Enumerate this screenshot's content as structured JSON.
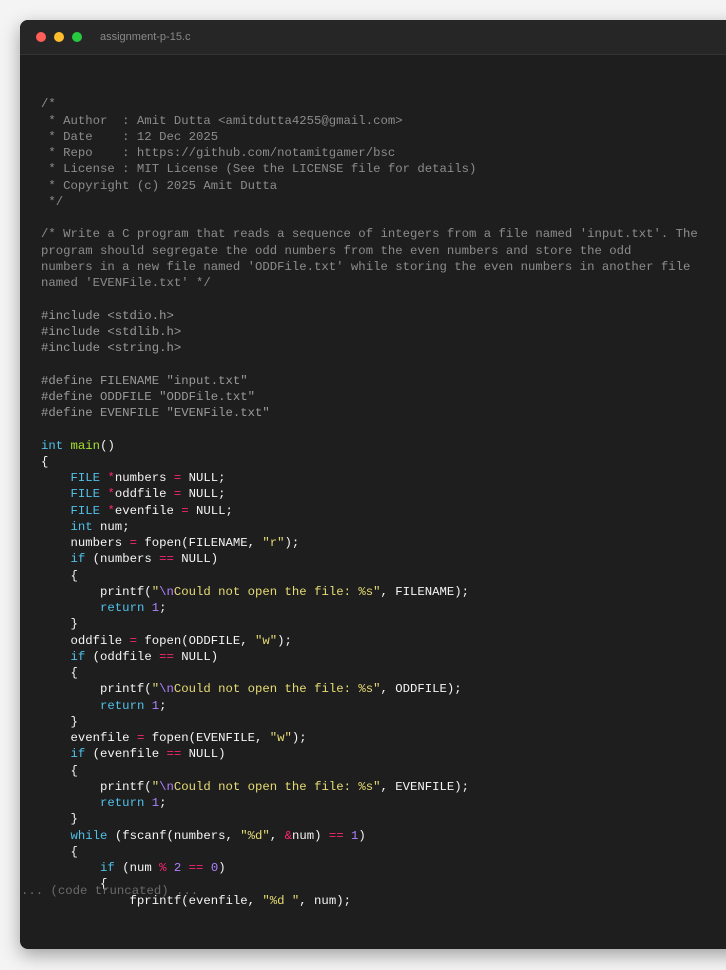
{
  "window": {
    "title": "assignment-p-15.c",
    "controls": {
      "close": "close-icon",
      "minimize": "minimize-icon",
      "maximize": "maximize-icon"
    }
  },
  "colors": {
    "background": "#1e1e1e",
    "titlebar": "#262626",
    "comment": "#8c8c8c",
    "keyword": "#4fc1e9",
    "function": "#a6e22e",
    "string": "#e6db74",
    "number": "#ae81ff",
    "operator": "#f92672"
  },
  "code": {
    "lines": [
      [],
      [
        {
          "t": "c",
          "v": "/*"
        }
      ],
      [
        {
          "t": "c",
          "v": " * Author  : Amit Dutta <amitdutta4255@gmail.com>"
        }
      ],
      [
        {
          "t": "c",
          "v": " * Date    : 12 Dec 2025"
        }
      ],
      [
        {
          "t": "c",
          "v": " * Repo    : https://github.com/notamitgamer/bsc"
        }
      ],
      [
        {
          "t": "c",
          "v": " * License : MIT License (See the LICENSE file for details)"
        }
      ],
      [
        {
          "t": "c",
          "v": " * Copyright (c) 2025 Amit Dutta"
        }
      ],
      [
        {
          "t": "c",
          "v": " */"
        }
      ],
      [],
      [
        {
          "t": "c",
          "v": "/* Write a C program that reads a sequence of integers from a file named 'input.txt'. The"
        }
      ],
      [
        {
          "t": "c",
          "v": "program should segregate the odd numbers from the even numbers and store the odd"
        }
      ],
      [
        {
          "t": "c",
          "v": "numbers in a new file named 'ODDFile.txt' while storing the even numbers in another file"
        }
      ],
      [
        {
          "t": "c",
          "v": "named 'EVENFile.txt' */"
        }
      ],
      [],
      [
        {
          "t": "p",
          "v": "#include <stdio.h>"
        }
      ],
      [
        {
          "t": "p",
          "v": "#include <stdlib.h>"
        }
      ],
      [
        {
          "t": "p",
          "v": "#include <string.h>"
        }
      ],
      [],
      [
        {
          "t": "p",
          "v": "#define FILENAME \"input.txt\""
        }
      ],
      [
        {
          "t": "p",
          "v": "#define ODDFILE \"ODDFile.txt\""
        }
      ],
      [
        {
          "t": "p",
          "v": "#define EVENFILE \"EVENFile.txt\""
        }
      ],
      [],
      [
        {
          "t": "k",
          "v": "int"
        },
        {
          "t": "x",
          "v": " "
        },
        {
          "t": "f",
          "v": "main"
        },
        {
          "t": "x",
          "v": "()"
        }
      ],
      [
        {
          "t": "x",
          "v": "{"
        }
      ],
      [
        {
          "t": "x",
          "v": "    "
        },
        {
          "t": "k",
          "v": "FILE"
        },
        {
          "t": "x",
          "v": " "
        },
        {
          "t": "o",
          "v": "*"
        },
        {
          "t": "x",
          "v": "numbers "
        },
        {
          "t": "o",
          "v": "="
        },
        {
          "t": "x",
          "v": " NULL;"
        }
      ],
      [
        {
          "t": "x",
          "v": "    "
        },
        {
          "t": "k",
          "v": "FILE"
        },
        {
          "t": "x",
          "v": " "
        },
        {
          "t": "o",
          "v": "*"
        },
        {
          "t": "x",
          "v": "oddfile "
        },
        {
          "t": "o",
          "v": "="
        },
        {
          "t": "x",
          "v": " NULL;"
        }
      ],
      [
        {
          "t": "x",
          "v": "    "
        },
        {
          "t": "k",
          "v": "FILE"
        },
        {
          "t": "x",
          "v": " "
        },
        {
          "t": "o",
          "v": "*"
        },
        {
          "t": "x",
          "v": "evenfile "
        },
        {
          "t": "o",
          "v": "="
        },
        {
          "t": "x",
          "v": " NULL;"
        }
      ],
      [
        {
          "t": "x",
          "v": "    "
        },
        {
          "t": "k",
          "v": "int"
        },
        {
          "t": "x",
          "v": " num;"
        }
      ],
      [
        {
          "t": "x",
          "v": "    numbers "
        },
        {
          "t": "o",
          "v": "="
        },
        {
          "t": "x",
          "v": " fopen(FILENAME, "
        },
        {
          "t": "s",
          "v": "\"r\""
        },
        {
          "t": "x",
          "v": ");"
        }
      ],
      [
        {
          "t": "x",
          "v": "    "
        },
        {
          "t": "k",
          "v": "if"
        },
        {
          "t": "x",
          "v": " (numbers "
        },
        {
          "t": "o",
          "v": "=="
        },
        {
          "t": "x",
          "v": " NULL)"
        }
      ],
      [
        {
          "t": "x",
          "v": "    {"
        }
      ],
      [
        {
          "t": "x",
          "v": "        printf("
        },
        {
          "t": "s",
          "v": "\""
        },
        {
          "t": "e",
          "v": "\\n"
        },
        {
          "t": "s",
          "v": "Could not open the file: %s\""
        },
        {
          "t": "x",
          "v": ", FILENAME);"
        }
      ],
      [
        {
          "t": "x",
          "v": "        "
        },
        {
          "t": "k",
          "v": "return"
        },
        {
          "t": "x",
          "v": " "
        },
        {
          "t": "n",
          "v": "1"
        },
        {
          "t": "x",
          "v": ";"
        }
      ],
      [
        {
          "t": "x",
          "v": "    }"
        }
      ],
      [
        {
          "t": "x",
          "v": "    oddfile "
        },
        {
          "t": "o",
          "v": "="
        },
        {
          "t": "x",
          "v": " fopen(ODDFILE, "
        },
        {
          "t": "s",
          "v": "\"w\""
        },
        {
          "t": "x",
          "v": ");"
        }
      ],
      [
        {
          "t": "x",
          "v": "    "
        },
        {
          "t": "k",
          "v": "if"
        },
        {
          "t": "x",
          "v": " (oddfile "
        },
        {
          "t": "o",
          "v": "=="
        },
        {
          "t": "x",
          "v": " NULL)"
        }
      ],
      [
        {
          "t": "x",
          "v": "    {"
        }
      ],
      [
        {
          "t": "x",
          "v": "        printf("
        },
        {
          "t": "s",
          "v": "\""
        },
        {
          "t": "e",
          "v": "\\n"
        },
        {
          "t": "s",
          "v": "Could not open the file: %s\""
        },
        {
          "t": "x",
          "v": ", ODDFILE);"
        }
      ],
      [
        {
          "t": "x",
          "v": "        "
        },
        {
          "t": "k",
          "v": "return"
        },
        {
          "t": "x",
          "v": " "
        },
        {
          "t": "n",
          "v": "1"
        },
        {
          "t": "x",
          "v": ";"
        }
      ],
      [
        {
          "t": "x",
          "v": "    }"
        }
      ],
      [
        {
          "t": "x",
          "v": "    evenfile "
        },
        {
          "t": "o",
          "v": "="
        },
        {
          "t": "x",
          "v": " fopen(EVENFILE, "
        },
        {
          "t": "s",
          "v": "\"w\""
        },
        {
          "t": "x",
          "v": ");"
        }
      ],
      [
        {
          "t": "x",
          "v": "    "
        },
        {
          "t": "k",
          "v": "if"
        },
        {
          "t": "x",
          "v": " (evenfile "
        },
        {
          "t": "o",
          "v": "=="
        },
        {
          "t": "x",
          "v": " NULL)"
        }
      ],
      [
        {
          "t": "x",
          "v": "    {"
        }
      ],
      [
        {
          "t": "x",
          "v": "        printf("
        },
        {
          "t": "s",
          "v": "\""
        },
        {
          "t": "e",
          "v": "\\n"
        },
        {
          "t": "s",
          "v": "Could not open the file: %s\""
        },
        {
          "t": "x",
          "v": ", EVENFILE);"
        }
      ],
      [
        {
          "t": "x",
          "v": "        "
        },
        {
          "t": "k",
          "v": "return"
        },
        {
          "t": "x",
          "v": " "
        },
        {
          "t": "n",
          "v": "1"
        },
        {
          "t": "x",
          "v": ";"
        }
      ],
      [
        {
          "t": "x",
          "v": "    }"
        }
      ],
      [
        {
          "t": "x",
          "v": "    "
        },
        {
          "t": "k",
          "v": "while"
        },
        {
          "t": "x",
          "v": " (fscanf(numbers, "
        },
        {
          "t": "s",
          "v": "\"%d\""
        },
        {
          "t": "x",
          "v": ", "
        },
        {
          "t": "o",
          "v": "&"
        },
        {
          "t": "x",
          "v": "num) "
        },
        {
          "t": "o",
          "v": "=="
        },
        {
          "t": "x",
          "v": " "
        },
        {
          "t": "n",
          "v": "1"
        },
        {
          "t": "x",
          "v": ")"
        }
      ],
      [
        {
          "t": "x",
          "v": "    {"
        }
      ],
      [
        {
          "t": "x",
          "v": "        "
        },
        {
          "t": "k",
          "v": "if"
        },
        {
          "t": "x",
          "v": " (num "
        },
        {
          "t": "o",
          "v": "%"
        },
        {
          "t": "x",
          "v": " "
        },
        {
          "t": "n",
          "v": "2"
        },
        {
          "t": "x",
          "v": " "
        },
        {
          "t": "o",
          "v": "=="
        },
        {
          "t": "x",
          "v": " "
        },
        {
          "t": "n",
          "v": "0"
        },
        {
          "t": "x",
          "v": ")"
        }
      ],
      [
        {
          "t": "x",
          "v": "        {"
        }
      ],
      [
        {
          "t": "x",
          "v": "            fprintf(evenfile, "
        },
        {
          "t": "s",
          "v": "\"%d \""
        },
        {
          "t": "x",
          "v": ", num);"
        }
      ]
    ],
    "truncated_note": "... (code truncated) ..."
  }
}
